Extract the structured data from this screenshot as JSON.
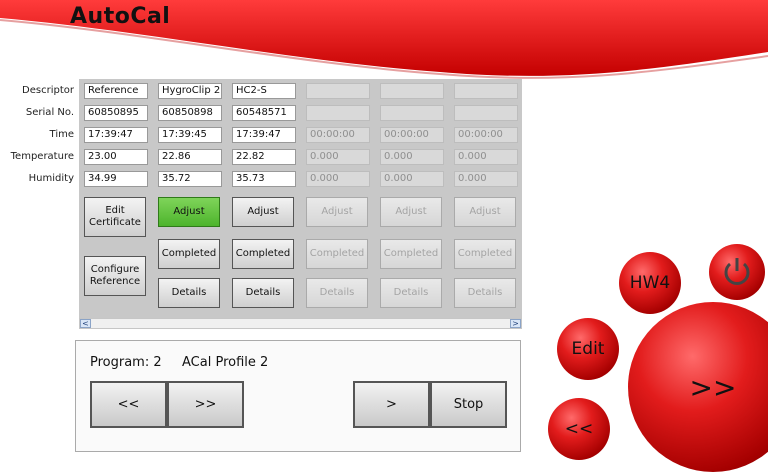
{
  "app": {
    "title": "AutoCal"
  },
  "row_labels": [
    "Descriptor",
    "Serial No.",
    "Time",
    "Temperature",
    "Humidity"
  ],
  "columns": [
    {
      "enabled": true,
      "descriptor": "Reference",
      "serial": "60850895",
      "time": "17:39:47",
      "temperature": "23.00",
      "humidity": "34.99"
    },
    {
      "enabled": true,
      "descriptor": "HygroClip 2",
      "serial": "60850898",
      "time": "17:39:45",
      "temperature": "22.86",
      "humidity": "35.72"
    },
    {
      "enabled": true,
      "descriptor": "HC2-S",
      "serial": "60548571",
      "time": "17:39:47",
      "temperature": "22.82",
      "humidity": "35.73"
    },
    {
      "enabled": false,
      "descriptor": "",
      "serial": "",
      "time": "00:00:00",
      "temperature": "0.000",
      "humidity": "0.000"
    },
    {
      "enabled": false,
      "descriptor": "",
      "serial": "",
      "time": "00:00:00",
      "temperature": "0.000",
      "humidity": "0.000"
    },
    {
      "enabled": false,
      "descriptor": "",
      "serial": "",
      "time": "00:00:00",
      "temperature": "0.000",
      "humidity": "0.000"
    }
  ],
  "reference_buttons": {
    "edit_certificate": "Edit Certificate",
    "configure_reference": "Configure Reference"
  },
  "column_buttons": {
    "adjust": "Adjust",
    "completed": "Completed",
    "details": "Details"
  },
  "scrollbar": {
    "left_arrow": "<",
    "right_arrow": ">"
  },
  "program": {
    "label": "Program: 2",
    "profile": "ACal Profile 2"
  },
  "controls": {
    "back": "<<",
    "forward": ">>",
    "next": ">",
    "stop": "Stop"
  },
  "nav_balls": {
    "hw": "HW4",
    "edit": "Edit",
    "forward": ">>",
    "back": "<<",
    "power_icon": "power-icon"
  },
  "colors": {
    "brand_red": "#e21c1c",
    "active_green": "#5cc236"
  }
}
